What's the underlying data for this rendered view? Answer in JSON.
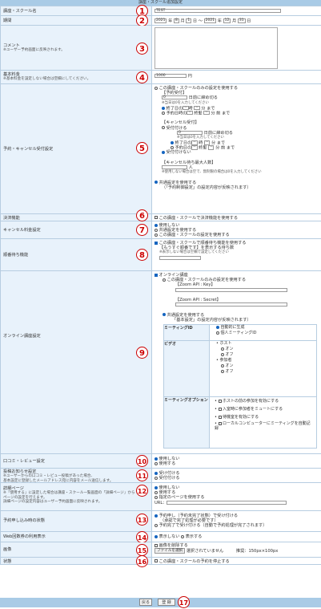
{
  "title": "講座・スクール追加設定",
  "rows": {
    "name": {
      "label": "講座・スクール名",
      "value": "TEST"
    },
    "period": {
      "label": "期間",
      "start_year": "2021",
      "start_month": "8",
      "start_day": "1",
      "end_year": "2021",
      "end_month": "12",
      "end_day": "31",
      "u_year": "年",
      "u_month": "月",
      "u_day": "日",
      "tilde": "〜"
    },
    "comment": {
      "label": "コメント",
      "note": "※ユーザー予約画面に反映されます。"
    },
    "fee": {
      "label": "基本料金",
      "note": "※基本料金を設定しない場合は空欄にしてください。",
      "value": "1000",
      "unit": "円"
    },
    "booking": {
      "label": "予約・キャンセル受付設定",
      "opt_own": "この講座・スクールのみの設定を使用する",
      "res_title": "【予約受付】",
      "res_days": "0",
      "res_days_suffix": "日前に締め切る",
      "res_note": "※当日は0を入力してください",
      "res_day_prev": "終了日の",
      "time_h": "--",
      "time_m": "--",
      "u_hour": "時",
      "u_min": "分",
      "made": "まで",
      "res_day_mid": "予約日時の",
      "res_end_time": "終髪",
      "u_min_made": "分 前 まで",
      "can_title": "【キャンセル受付】",
      "can_accept": "受付付ける",
      "can_days": "0",
      "can_days_suffix": "日前に締め切る",
      "can_note": "※当日は0を入力してください",
      "can_day_end": "終了日の",
      "can_day_res": "予約日の",
      "can_end": "終髪",
      "can_min_made": "分 前 まで",
      "can_reject": "受付付けない",
      "wait_title": "【キャンセル待ち最大人数】",
      "wait_unit": "人",
      "wait_note": "※使用しない場合は空で、無制限の場合は0を入力してください",
      "common_opt": "共通設定を使用する",
      "common_note": "（「予約制御設定」の設定内容が反映されます）"
    },
    "payment": {
      "label": "決済機能",
      "opt": "この講座・スクールで決済機能を使用する"
    },
    "cancel_fee": {
      "label": "キャンセル料金設定",
      "opts": [
        "使用しない",
        "共通設定を使用する",
        "この講座・スクールの設定を使用する"
      ]
    },
    "waitlist": {
      "label": "順番待ち機能",
      "opt": "この講座・スクールで順番待ち機能を使用する",
      "sub": "【もうすぐ順番です】を表示する待ち数",
      "sub_note": "※表示しない場合は空欄で設定してください"
    },
    "online": {
      "label": "オンライン講座設定",
      "opt": "オンライン講座",
      "own": "この講座・スクールのみの設定を使用する",
      "api_key": "【Zoom API : Key】",
      "api_secret": "【Zoom API : Secret】",
      "common": "共通設定を使用する",
      "common_note": "「基本設定」の設定内容が反映されます）",
      "mid_label": "ミーティングID",
      "mid_opts": [
        "自動的に生成",
        "個人ミーティングID"
      ],
      "video_label": "ビデオ",
      "host": "ホスト",
      "participant": "参加者",
      "on": "オン",
      "off": "オフ",
      "mopt_label": "ミーティングオプション",
      "mopts": [
        "ホストの前の参加を有効にする",
        "入室時に参加者をミュートにする",
        "待機室を有効にする",
        "ローカルコンピューターにミーティングを自動記録"
      ]
    },
    "review": {
      "label": "口コミ・レビュー設定",
      "opts": [
        "使用しない",
        "使用する"
      ]
    },
    "notice": {
      "label": "投稿お知らせ設定",
      "note1": "※ユーザーからの口コミ・レビュー投稿があった場合、",
      "note2": "基本設定に登録したメールアドレス宛に内容をメール送信します。",
      "opts": [
        "受け付ける",
        "受付付ける"
      ]
    },
    "detail": {
      "label": "詳細ページ",
      "note1": "※「使用する」に設定した場合は講座・スクール一覧画面の「詳細ページ」から",
      "note2": "ページの設定を行えます。",
      "note3": "詳細ページの設定内容はユーザー予約画面に反映されます。",
      "opts": [
        "使用しない",
        "使用する",
        "指定のページを使用する"
      ],
      "url": "URL："
    },
    "reserve_status": {
      "label": "予約申し込み時の状態",
      "opt1": "予約申し（予約未完了状態）で受け付ける",
      "opt1_note": "（承認で完了処理が必要です）",
      "opt2": "予約完了で受け付ける（自動で予約処理が完了されます）"
    },
    "web_count": {
      "label": "Web回数券の利用表示",
      "opts": [
        "表示しない",
        "表示する"
      ]
    },
    "image": {
      "label": "画像",
      "delete": "画像を削除する",
      "file_btn": "ファイルを選択",
      "file_none": "選択されていません",
      "size": "推奨：150px×100px"
    },
    "state": {
      "label": "状態",
      "opt": "この講座・スクールの予約を停止する"
    }
  },
  "markers": [
    "1",
    "2",
    "3",
    "4",
    "5",
    "6",
    "7",
    "8",
    "9",
    "10",
    "11",
    "12",
    "13",
    "14",
    "15",
    "16",
    "17"
  ],
  "footer": {
    "back": "戻る",
    "register": "登 録"
  },
  "colors": {
    "header": "#a9cbe6",
    "label_bg": "#e8f2fb",
    "marker": "#cc0000"
  }
}
